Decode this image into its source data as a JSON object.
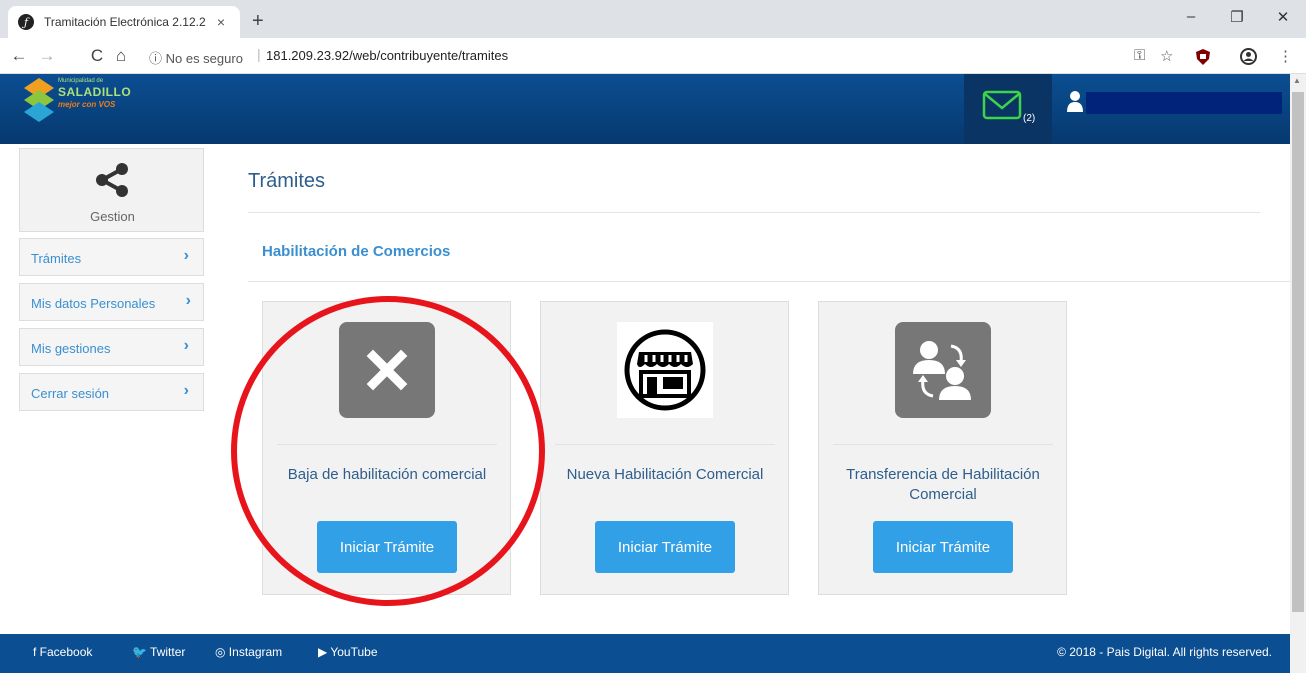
{
  "browser": {
    "tab_title": "Tramitación Electrónica 2.12.2",
    "tab_close": "×",
    "new_tab": "+",
    "url_info": "ⓘ No es seguro",
    "url_separator": "|",
    "url": "181.209.23.92/web/contribuyente/tramites",
    "back": "←",
    "forward": "→",
    "reload": "C",
    "home": "⌂",
    "minimize": "–",
    "maximize": "❐",
    "close": "✕",
    "key_icon": "⚿",
    "star_icon": "☆",
    "menu_icon": "⋮"
  },
  "header": {
    "logo_small": "Municipalidad de",
    "logo_main": "SALADILLO",
    "logo_tag": "mejor con VOS",
    "mail_count": "(2)",
    "brand_color": "#0b4e92"
  },
  "sidebar": {
    "card_label": "Gestion",
    "chevron": "›",
    "items": [
      {
        "label": "Trámites"
      },
      {
        "label": "Mis datos Personales"
      },
      {
        "label": "Mis gestiones"
      },
      {
        "label": "Cerrar sesión"
      }
    ]
  },
  "main": {
    "title": "Trámites",
    "section": "Habilitación de Comercios",
    "cards": [
      {
        "label": "Baja de habilitación comercial",
        "button": "Iniciar Trámite",
        "icon": "close-icon"
      },
      {
        "label": "Nueva Habilitación Comercial",
        "button": "Iniciar Trámite",
        "icon": "store-icon"
      },
      {
        "label": "Transferencia de Habilitación Comercial",
        "button": "Iniciar Trámite",
        "icon": "transfer-users-icon"
      }
    ],
    "button_color": "#32a0e6"
  },
  "footer": {
    "facebook": "f Facebook",
    "twitter": "🐦 Twitter",
    "instagram": "◎ Instagram",
    "youtube": "▶ YouTube",
    "copyright": "© 2018 - Pais Digital. All rights reserved."
  }
}
